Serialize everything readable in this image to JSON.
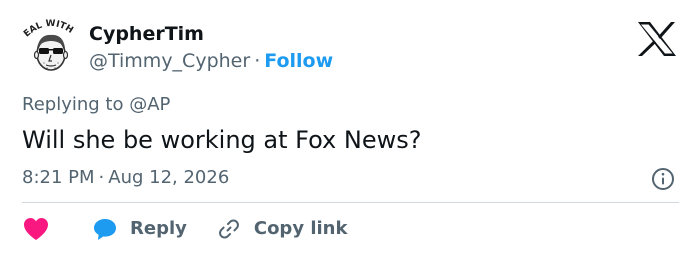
{
  "author": {
    "display_name": "CypherTim",
    "handle": "@Timmy_Cypher",
    "separator": "·",
    "follow_label": "Follow",
    "avatar_caption": "REAL WITH IT"
  },
  "tweet": {
    "replying_prefix": "Replying to ",
    "replying_to": "@AP",
    "text": "Will she be working at Fox News?",
    "time": "8:21 PM",
    "separator": "·",
    "date": "Aug 12, 2026"
  },
  "actions": {
    "reply_label": "Reply",
    "copy_link_label": "Copy link"
  },
  "colors": {
    "accent": "#1d9bf0",
    "heart": "#f91880",
    "text_primary": "#0f1419",
    "text_secondary": "#536471",
    "divider": "#cfd9de"
  },
  "icons": {
    "brand": "x-logo-icon",
    "info": "info-icon",
    "like": "heart-icon",
    "reply": "reply-bubble-icon",
    "copy": "link-icon"
  }
}
